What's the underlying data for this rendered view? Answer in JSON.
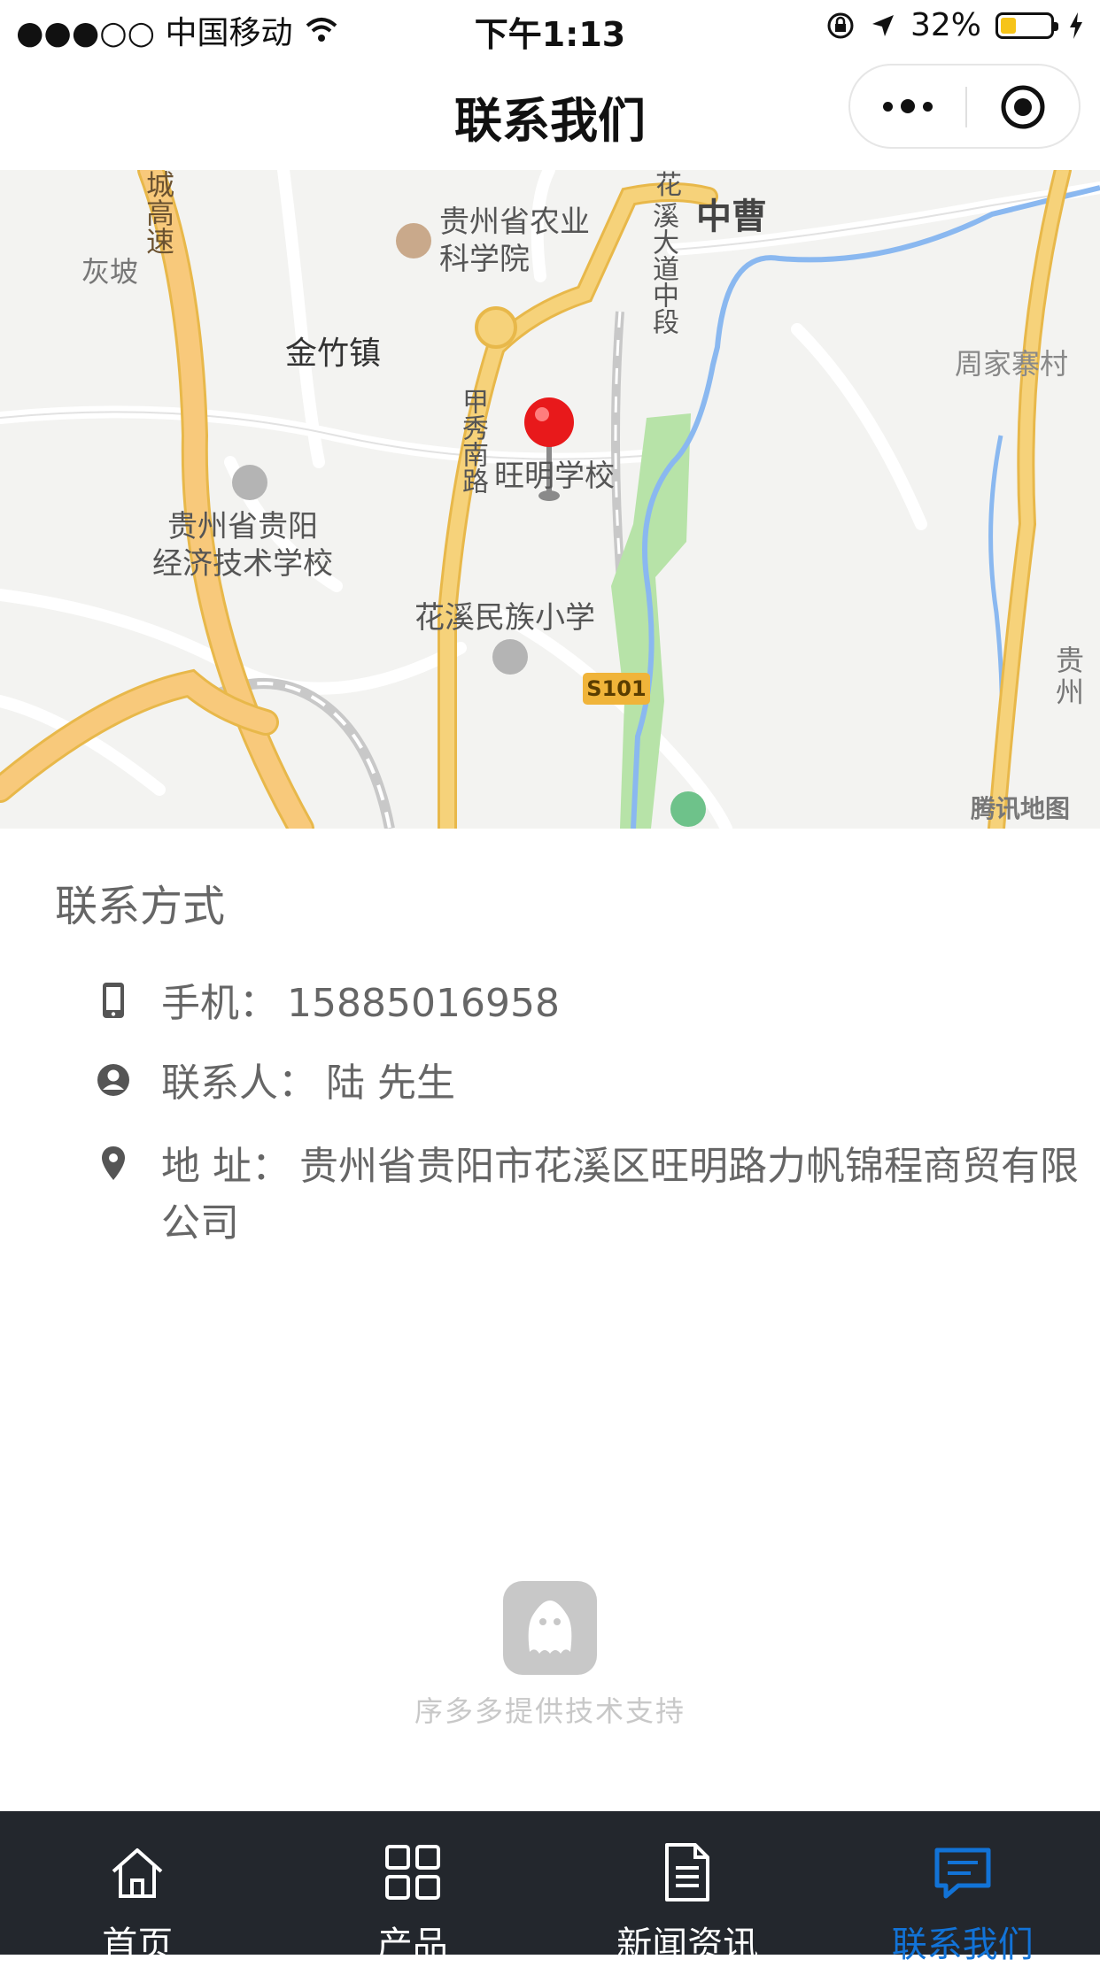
{
  "status_bar": {
    "carrier": "●●●○○ 中国移动",
    "time": "下午1:13",
    "battery_percent": "32%",
    "battery_level": 0.32
  },
  "nav": {
    "title": "联系我们"
  },
  "map": {
    "labels": {
      "highway": "城高速",
      "huipo": "灰坡",
      "academy": "贵州省农业\n科学院",
      "academy_l1": "贵州省农业",
      "academy_l2": "科学院",
      "huaxi_l1": "花",
      "road_huaxi": "溪大道中段",
      "zhongcao": "中曹",
      "jinzhu": "金竹镇",
      "zhoujia": "周家寨村",
      "jiaxiu": "甲秀南路",
      "wangming": "旺明学校",
      "school1_l1": "贵州省贵阳",
      "school1_l2": "经济技术学校",
      "huaxi_school": "花溪民族小学",
      "s101": "S101",
      "gui": "贵州",
      "tencent": "腾讯地图"
    },
    "colors": {
      "road_major": "#f6d27a",
      "road_major_stroke": "#e8b84a",
      "river": "#8ab8f0",
      "park": "#b7e3a8",
      "road_minor": "#ffffff",
      "marker": "#e8191b"
    }
  },
  "contact": {
    "title": "联系方式",
    "phone_label": "手机：",
    "phone_value": "15885016958",
    "person_label": "联系人：",
    "person_value": "陆 先生",
    "address_label": "地 址：",
    "address_value": "贵州省贵阳市花溪区旺明路力帆锦程商贸有限公司"
  },
  "support": {
    "text": "序多多提供技术支持"
  },
  "tabbar": {
    "items": [
      {
        "label": "首页",
        "icon": "home-icon"
      },
      {
        "label": "产品",
        "icon": "grid-icon"
      },
      {
        "label": "新闻资讯",
        "icon": "document-icon"
      },
      {
        "label": "联系我们",
        "icon": "message-icon"
      }
    ],
    "active_color": "#1273d7"
  }
}
